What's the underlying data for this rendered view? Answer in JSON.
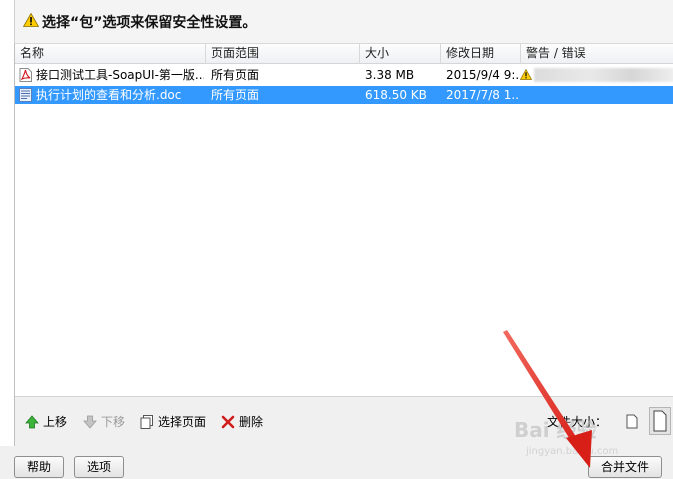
{
  "header": {
    "warning_text": "选择“包”选项来保留安全性设置。",
    "icon": "warning-icon"
  },
  "table": {
    "columns": [
      "名称",
      "页面范围",
      "大小",
      "修改日期",
      "警告 / 错误"
    ],
    "rows": [
      {
        "icon": "pdf-file-icon",
        "name": "接口测试工具-SoapUI-第一版...",
        "range": "所有页面",
        "size": "3.38 MB",
        "date": "2015/9/4 9:...",
        "warning_icon": "warning-icon",
        "selected": false
      },
      {
        "icon": "doc-file-icon",
        "name": "执行计划的查看和分析.doc",
        "range": "所有页面",
        "size": "618.50 KB",
        "date": "2017/7/8 1...",
        "selected": true
      }
    ]
  },
  "toolbar": {
    "move_up": "上移",
    "move_down": "下移",
    "select_pages": "选择页面",
    "delete": "删除",
    "file_size_label": "文件大小："
  },
  "footer": {
    "help": "帮助",
    "options": "选项",
    "merge": "合并文件"
  },
  "watermark": {
    "text": "Bai 经验",
    "url": "jingyan.baidu.com"
  },
  "colors": {
    "selection": "#3399ff",
    "annotation_arrow": "#e8362e"
  }
}
